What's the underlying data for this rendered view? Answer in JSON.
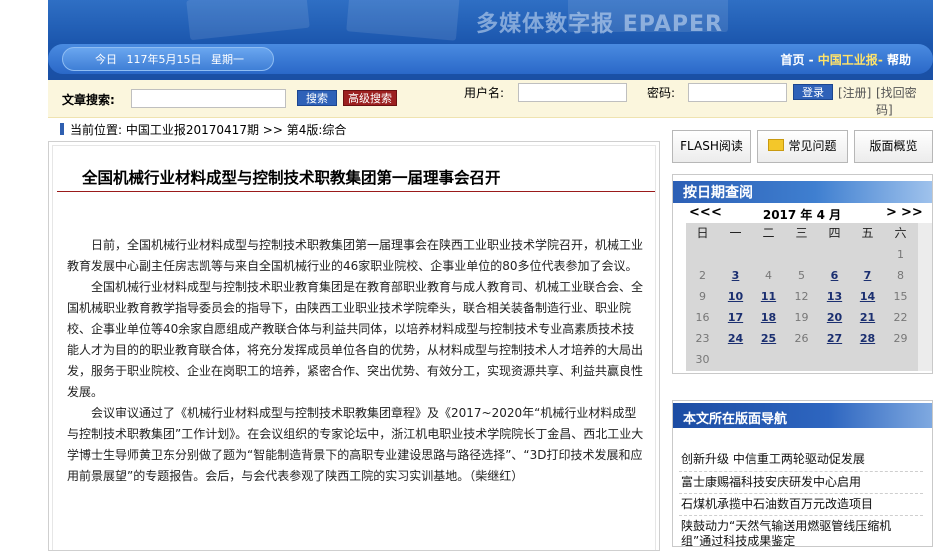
{
  "header": {
    "brand": "多媒体数字报 EPAPER",
    "date": [
      "今日",
      "117年5月15日",
      "星期一"
    ],
    "nav": [
      "首页",
      " - ",
      "中国工业报",
      "- ",
      "帮助"
    ]
  },
  "search": {
    "article_label": "文章搜索:",
    "search_button": "搜索",
    "advanced_button": "高级搜索",
    "username_label": "用户名:",
    "password_label": "密码:",
    "login_button": "登录",
    "register_link": "[注册]",
    "forgot_link": "[找回密码]"
  },
  "breadcrumb": {
    "label": "当前位置:",
    "paper": "中国工业报20170417期",
    "sep": ">>",
    "page": "第4版:综合"
  },
  "article": {
    "title": "全国机械行业材料成型与控制技术职教集团第一届理事会召开",
    "paragraphs": [
      "日前，全国机械行业材料成型与控制技术职教集团第一届理事会在陕西工业职业技术学院召开，机械工业教育发展中心副主任房志凯等与来自全国机械行业的46家职业院校、企事业单位的80多位代表参加了会议。",
      "全国机械行业材料成型与控制技术职业教育集团是在教育部职业教育与成人教育司、机械工业联合会、全国机械职业教育教学指导委员会的指导下，由陕西工业职业技术学院牵头，联合相关装备制造行业、职业院校、企事业单位等40余家自愿组成产教联合体与利益共同体，以培养材料成型与控制技术专业高素质技术技能人才为目的的职业教育联合体，将充分发挥成员单位各自的优势，从材料成型与控制技术人才培养的大局出发，服务于职业院校、企业在岗职工的培养，紧密合作、突出优势、有效分工，实现资源共享、利益共赢良性发展。",
      "会议审议通过了《机械行业材料成型与控制技术职教集团章程》及《2017~2020年“机械行业材料成型与控制技术职教集团”工作计划》。在会议组织的专家论坛中，浙江机电职业技术学院院长丁金昌、西北工业大学博士生导师黄卫东分别做了题为“智能制造背景下的高职专业建设思路与路径选择”、“3D打印技术发展和应用前景展望”的专题报告。会后，与会代表参观了陕西工院的实习实训基地。（柴继红）"
    ]
  },
  "tabs": {
    "flash": "FLASH阅读",
    "faq": "常见问题",
    "overview": "版面概览"
  },
  "calendar": {
    "title": "按日期查阅",
    "prev_year": "<<",
    "prev_month": "<",
    "month_label": "2017 年 4 月",
    "next_month": ">",
    "next_year": ">>",
    "weekdays": [
      "日",
      "一",
      "二",
      "三",
      "四",
      "五",
      "六"
    ],
    "weeks": [
      [
        "",
        "",
        "",
        "",
        "",
        "",
        "1"
      ],
      [
        "2",
        "3",
        "4",
        "5",
        "6",
        "7",
        "8"
      ],
      [
        "9",
        "10",
        "11",
        "12",
        "13",
        "14",
        "15"
      ],
      [
        "16",
        "17",
        "18",
        "19",
        "20",
        "21",
        "22"
      ],
      [
        "23",
        "24",
        "25",
        "26",
        "27",
        "28",
        "29"
      ],
      [
        "30",
        "",
        "",
        "",
        "",
        "",
        ""
      ]
    ],
    "linked_days": [
      "3",
      "6",
      "7",
      "10",
      "11",
      "13",
      "14",
      "17",
      "18",
      "20",
      "21",
      "24",
      "25",
      "27",
      "28"
    ]
  },
  "page_nav": {
    "title": "本文所在版面导航",
    "items": [
      "创新升级  中信重工两轮驱动促发展",
      "富士康赐福科技安庆研发中心启用",
      "石煤机承揽中石油数百万元改造项目",
      "陕鼓动力“天然气输送用燃驱管线压缩机组”通过科技成果鉴定"
    ]
  },
  "colors": {
    "header_blue": "#1b56ad",
    "search_bg": "#fbf6dd",
    "title_rule": "#9a1a1a",
    "current_nav": "#ffe36a"
  }
}
